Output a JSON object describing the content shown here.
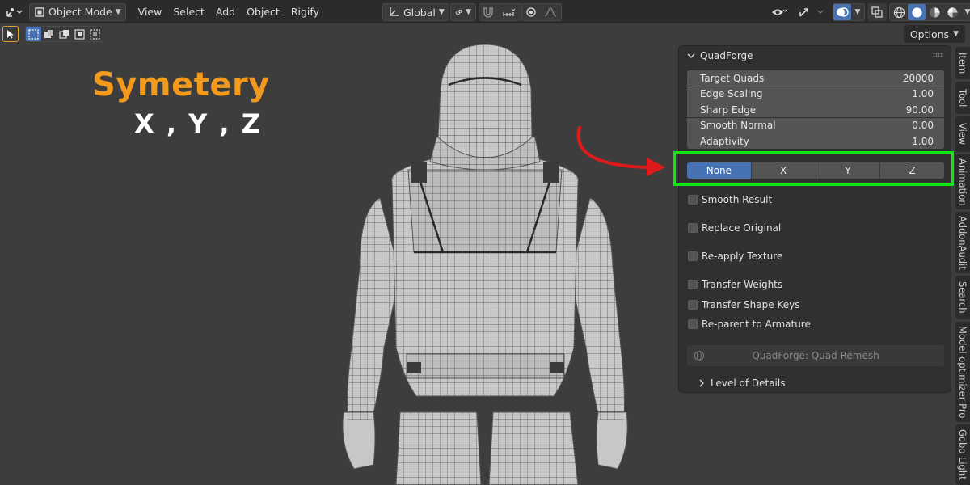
{
  "header": {
    "mode_label": "Object Mode",
    "menus": [
      "View",
      "Select",
      "Add",
      "Object",
      "Rigify"
    ],
    "transform_orientation": "Global"
  },
  "toolbar": {
    "options_label": "Options"
  },
  "overlay": {
    "title": "Symetery",
    "subtitle": "X , Y , Z"
  },
  "panel": {
    "title": "QuadForge",
    "fields": [
      {
        "label": "Target Quads",
        "value": "20000"
      },
      {
        "label": "Edge Scaling",
        "value": "1.00"
      },
      {
        "label": "Sharp Edge",
        "value": "90.00"
      },
      {
        "label": "Smooth Normal",
        "value": "0.00"
      },
      {
        "label": "Adaptivity",
        "value": "1.00"
      }
    ],
    "symmetry": {
      "options": [
        "None",
        "X",
        "Y",
        "Z"
      ],
      "selected": "None"
    },
    "checkboxes": [
      {
        "label": "Smooth Result",
        "checked": false
      },
      {
        "label": "Replace Original",
        "checked": false
      },
      {
        "label": "Re-apply Texture",
        "checked": false
      },
      {
        "label": "Transfer Weights",
        "checked": false
      },
      {
        "label": "Transfer Shape Keys",
        "checked": false
      },
      {
        "label": "Re-parent to Armature",
        "checked": false
      }
    ],
    "remesh_button": "QuadForge: Quad Remesh",
    "subpanel": "Level of Details"
  },
  "tabs": [
    "Item",
    "Tool",
    "View",
    "Animation",
    "AddonAudit",
    "Search",
    "Model optimizer Pro",
    "Gobo Light"
  ],
  "colors": {
    "accent": "#4772b3",
    "title": "#f39a1d",
    "highlight": "#14e614",
    "arrow": "#e01a1a"
  }
}
